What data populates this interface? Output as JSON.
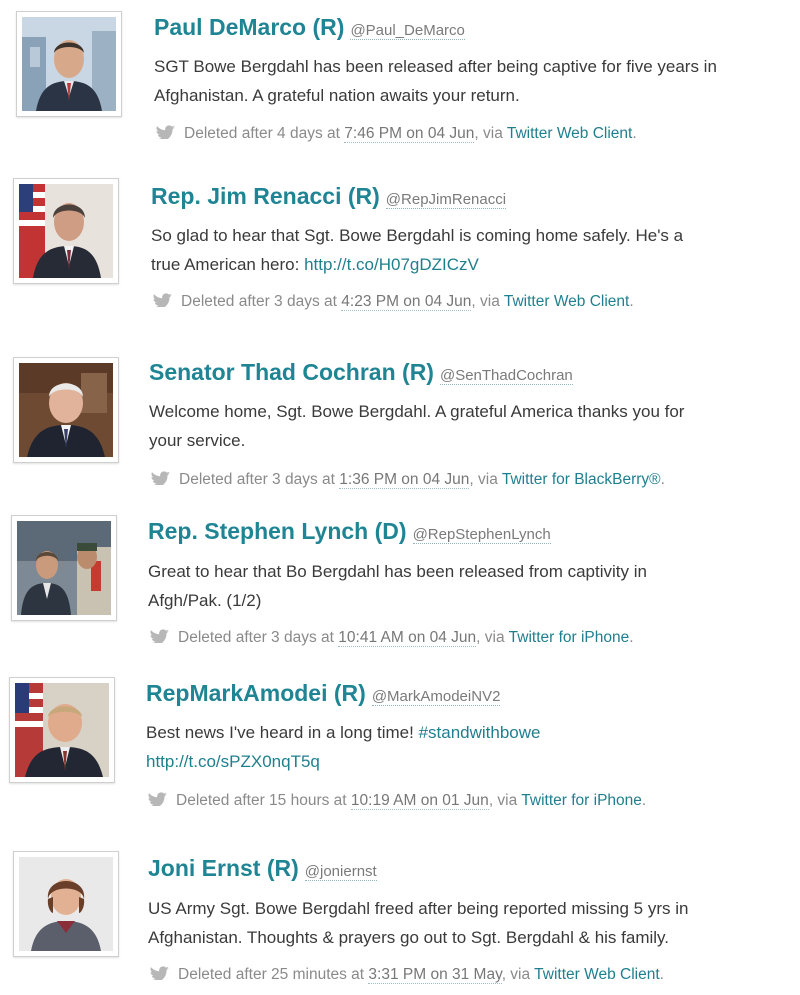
{
  "tweets": [
    {
      "name": "Paul DeMarco (R)",
      "handle": "@Paul_DeMarco",
      "text_line1": "SGT Bowe Bergdahl has been released after being captive for five years in",
      "text_line2": "Afghanistan. A grateful nation awaits your return.",
      "link": "",
      "deleted_after": "Deleted after 4 days at",
      "time": "7:46 PM on 04 Jun",
      "via": ", via",
      "client": "Twitter Web Client",
      "end": "."
    },
    {
      "name": "Rep. Jim Renacci (R)",
      "handle": "@RepJimRenacci",
      "text_line1": "So glad to hear that Sgt. Bowe Bergdahl is coming home safely. He's a",
      "text_line2": "true American hero: ",
      "link": "http://t.co/H07gDZICzV",
      "deleted_after": "Deleted after 3 days at",
      "time": "4:23 PM on 04 Jun",
      "via": ", via",
      "client": "Twitter Web Client",
      "end": "."
    },
    {
      "name": "Senator Thad Cochran (R)",
      "handle": "@SenThadCochran",
      "text_line1": "Welcome home, Sgt. Bowe Bergdahl. A grateful America thanks you for",
      "text_line2": "your service.",
      "link": "",
      "deleted_after": "Deleted after 3 days at",
      "time": "1:36 PM on 04 Jun",
      "via": ", via",
      "client": "Twitter for BlackBerry®",
      "end": "."
    },
    {
      "name": "Rep. Stephen Lynch (D)",
      "handle": "@RepStephenLynch",
      "text_line1": "Great to hear that Bo Bergdahl has been released from captivity in",
      "text_line2": "Afgh/Pak. (1/2)",
      "link": "",
      "deleted_after": "Deleted after 3 days at",
      "time": "10:41 AM on 04 Jun",
      "via": ", via",
      "client": "Twitter for iPhone",
      "end": "."
    },
    {
      "name": "RepMarkAmodei (R)",
      "handle": "@MarkAmodeiNV2",
      "text_line1": "Best news I've heard in a long time! ",
      "hashtag": "#standwithbowe",
      "text_line2": "",
      "link": "http://t.co/sPZX0nqT5q",
      "deleted_after": "Deleted after 15 hours at",
      "time": "10:19 AM on 01 Jun",
      "via": ", via",
      "client": "Twitter for iPhone",
      "end": "."
    },
    {
      "name": "Joni Ernst (R)",
      "handle": "@joniernst",
      "text_line1": "US Army Sgt. Bowe Bergdahl freed after being reported missing 5 yrs in",
      "text_line2": "Afghanistan. Thoughts & prayers go out to Sgt. Bergdahl & his family.",
      "link": "",
      "deleted_after": "Deleted after 25 minutes at",
      "time": "3:31 PM on 31 May",
      "via": ", via",
      "client": "Twitter Web Client",
      "end": "."
    }
  ]
}
